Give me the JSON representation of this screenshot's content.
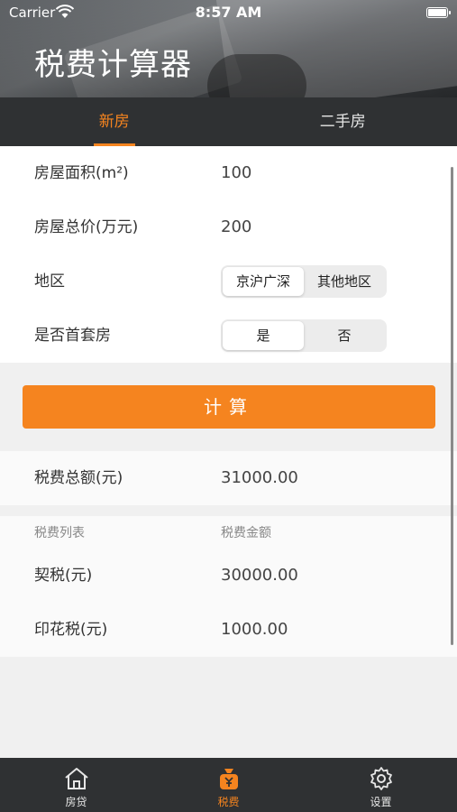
{
  "status_bar": {
    "carrier": "Carrier",
    "time": "8:57 AM"
  },
  "page_title": "税费计算器",
  "tabs": [
    {
      "label": "新房",
      "active": true
    },
    {
      "label": "二手房",
      "active": false
    }
  ],
  "form": {
    "area": {
      "label": "房屋面积(m²)",
      "value": "100"
    },
    "total_price": {
      "label": "房屋总价(万元)",
      "value": "200"
    },
    "region": {
      "label": "地区",
      "options": [
        "京沪广深",
        "其他地区"
      ],
      "selected": "京沪广深"
    },
    "first_home": {
      "label": "是否首套房",
      "options": [
        "是",
        "否"
      ],
      "selected": "是"
    }
  },
  "calculate_label": "计算",
  "total": {
    "label": "税费总额(元)",
    "value": "31000.00"
  },
  "results": {
    "columns": [
      "税费列表",
      "税费金额"
    ],
    "rows": [
      {
        "label": "契税(元)",
        "value": "30000.00"
      },
      {
        "label": "印花税(元)",
        "value": "1000.00"
      }
    ]
  },
  "bottom_nav": [
    {
      "label": "房贷",
      "icon": "house-icon",
      "active": false
    },
    {
      "label": "税费",
      "icon": "tax-bag-icon",
      "active": true
    },
    {
      "label": "设置",
      "icon": "gear-icon",
      "active": false
    }
  ],
  "colors": {
    "accent": "#f5841f",
    "dark_bar": "#2f3133"
  }
}
